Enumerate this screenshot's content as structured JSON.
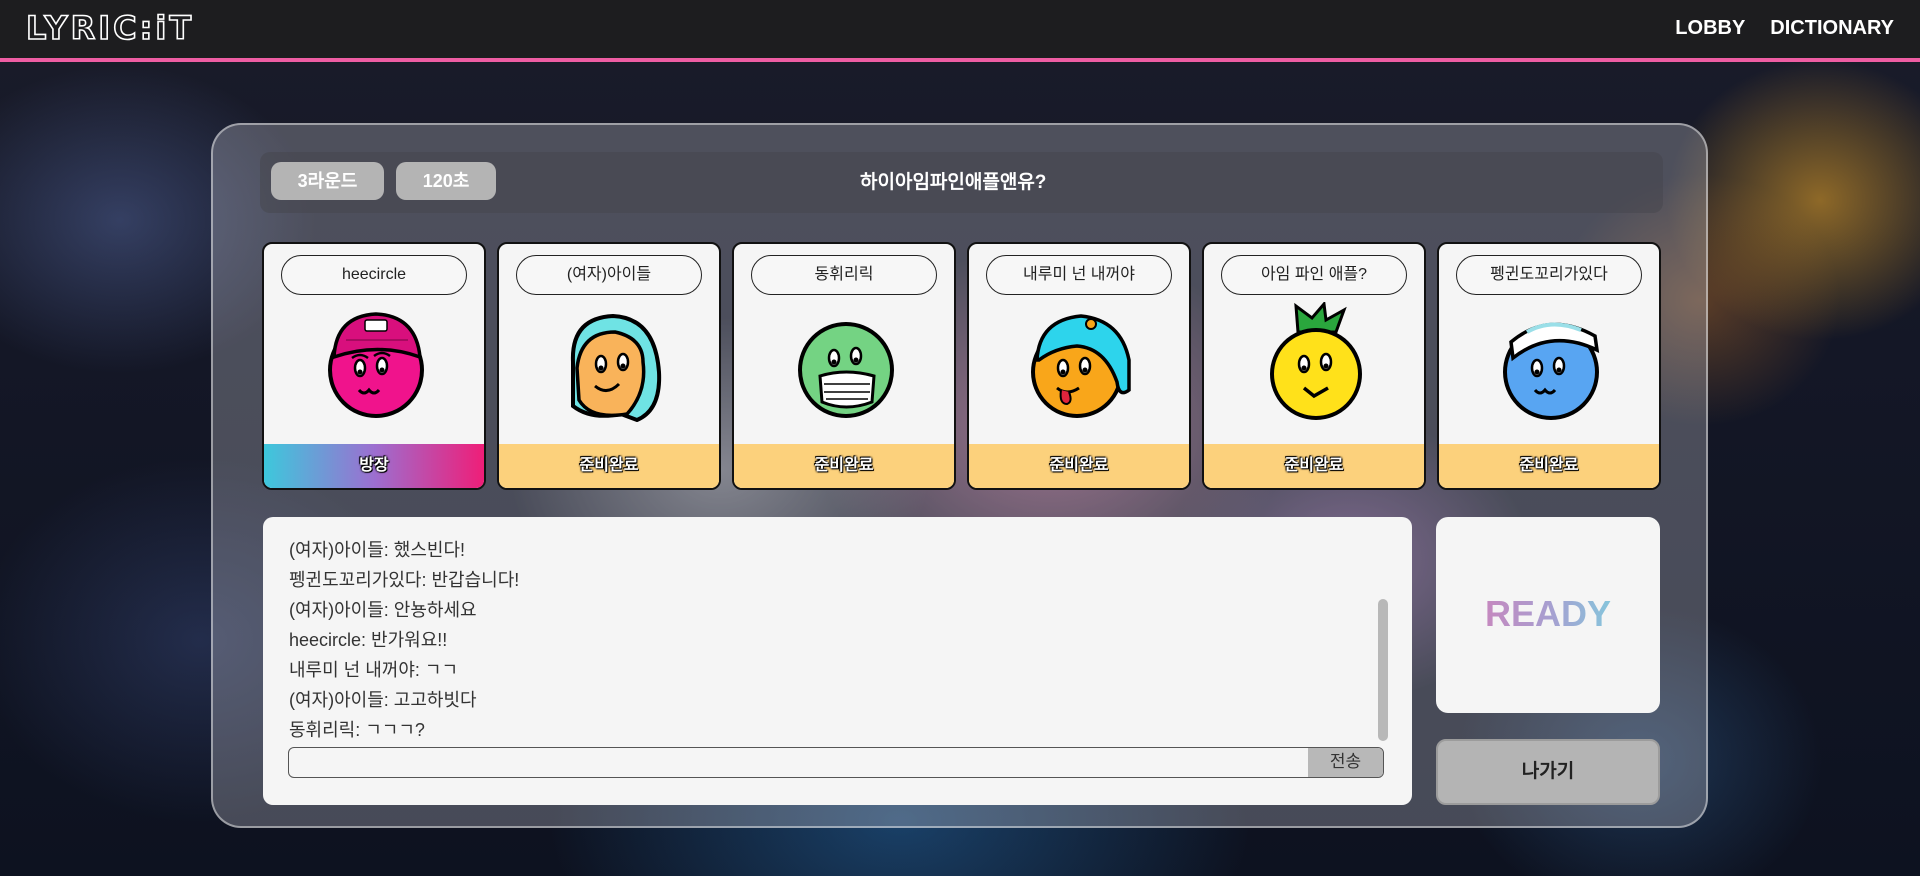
{
  "app": {
    "logo": "LYRIC:iT"
  },
  "nav": {
    "items": [
      {
        "label": "LOBBY"
      },
      {
        "label": "DICTIONARY"
      }
    ]
  },
  "room": {
    "rounds_label": "3라운드",
    "time_label": "120초",
    "title": "하이아임파인애플앤유?"
  },
  "players": [
    {
      "name": "heecircle",
      "status": "방장",
      "avatar": "pink-beanie-avatar-icon",
      "color": "#f0138c"
    },
    {
      "name": "(여자)아이들",
      "status": "준비완료",
      "avatar": "aqua-hair-avatar-icon",
      "color": "#f9b35a"
    },
    {
      "name": "동휘리릭",
      "status": "준비완료",
      "avatar": "mask-green-avatar-icon",
      "color": "#74d383"
    },
    {
      "name": "내루미 넌 내꺼야",
      "status": "준비완료",
      "avatar": "cap-orange-avatar-icon",
      "color": "#f9a61a"
    },
    {
      "name": "아임 파인 애플?",
      "status": "준비완료",
      "avatar": "pineapple-avatar-icon",
      "color": "#ffe11a"
    },
    {
      "name": "펭귄도꼬리가있다",
      "status": "준비완료",
      "avatar": "goggles-blue-avatar-icon",
      "color": "#58a5f2"
    }
  ],
  "chat": {
    "messages": [
      "(여자)아이들: 했스빈다!",
      "펭귄도꼬리가있다: 반갑습니다!",
      "(여자)아이들: 안뇽하세요",
      "heecircle: 반가워요!!",
      "내루미 넌 내꺼야: ㄱㄱ",
      "(여자)아이들: 고고하빗다",
      "동휘리릭: ㄱㄱㄱ?"
    ],
    "input_value": "",
    "send_label": "전송"
  },
  "actions": {
    "ready_label": "READY",
    "exit_label": "나가기"
  },
  "colors": {
    "accent": "#ee5da3",
    "ready_status": "#fcd17c"
  }
}
